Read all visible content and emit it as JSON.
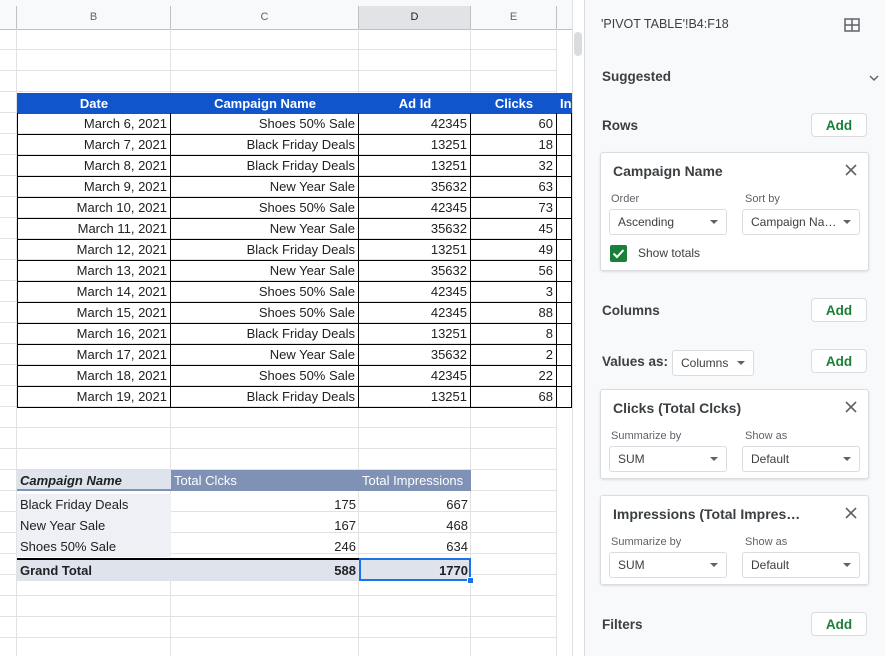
{
  "column_headers": [
    "B",
    "C",
    "D",
    "E",
    ""
  ],
  "source_table": {
    "headers": [
      "Date",
      "Campaign Name",
      "Ad Id",
      "Clicks",
      "In"
    ],
    "rows": [
      [
        "March 6, 2021",
        "Shoes 50% Sale",
        "42345",
        "60"
      ],
      [
        "March 7, 2021",
        "Black Friday Deals",
        "13251",
        "18"
      ],
      [
        "March 8, 2021",
        "Black Friday Deals",
        "13251",
        "32"
      ],
      [
        "March 9, 2021",
        "New Year Sale",
        "35632",
        "63"
      ],
      [
        "March 10, 2021",
        "Shoes 50% Sale",
        "42345",
        "73"
      ],
      [
        "March 11, 2021",
        "New Year Sale",
        "35632",
        "45"
      ],
      [
        "March 12, 2021",
        "Black Friday Deals",
        "13251",
        "49"
      ],
      [
        "March 13, 2021",
        "New Year Sale",
        "35632",
        "56"
      ],
      [
        "March 14, 2021",
        "Shoes 50% Sale",
        "42345",
        "3"
      ],
      [
        "March 15, 2021",
        "Shoes 50% Sale",
        "42345",
        "88"
      ],
      [
        "March 16, 2021",
        "Black Friday Deals",
        "13251",
        "8"
      ],
      [
        "March 17, 2021",
        "New Year Sale",
        "35632",
        "2"
      ],
      [
        "March 18, 2021",
        "Shoes 50% Sale",
        "42345",
        "22"
      ],
      [
        "March 19, 2021",
        "Black Friday Deals",
        "13251",
        "68"
      ]
    ]
  },
  "pivot_table": {
    "headers": [
      "Campaign Name",
      "Total Clcks",
      "Total Impressions"
    ],
    "rows": [
      [
        "Black Friday Deals",
        "175",
        "667"
      ],
      [
        "New Year Sale",
        "167",
        "468"
      ],
      [
        "Shoes 50% Sale",
        "246",
        "634"
      ]
    ],
    "grand_total": [
      "Grand Total",
      "588",
      "1770"
    ]
  },
  "editor": {
    "range": "'PIVOT TABLE'!B4:F18",
    "suggested_label": "Suggested",
    "rows_label": "Rows",
    "columns_label": "Columns",
    "values_as_label": "Values as:",
    "values_as_value": "Columns",
    "filters_label": "Filters",
    "add_label": "Add",
    "row_card": {
      "title": "Campaign Name",
      "order_label": "Order",
      "order_value": "Ascending",
      "sort_by_label": "Sort by",
      "sort_by_value": "Campaign Na…",
      "show_totals_label": "Show totals"
    },
    "value_cards": [
      {
        "title": "Clicks (Total Clcks)",
        "summarize_label": "Summarize by",
        "summarize_value": "SUM",
        "show_as_label": "Show as",
        "show_as_value": "Default"
      },
      {
        "title": "Impressions (Total Impres…",
        "summarize_label": "Summarize by",
        "summarize_value": "SUM",
        "show_as_label": "Show as",
        "show_as_value": "Default"
      }
    ]
  },
  "colors": {
    "header_blue": "#1155cc",
    "pivot_header": "#7f91b4",
    "add_green": "#188038"
  }
}
